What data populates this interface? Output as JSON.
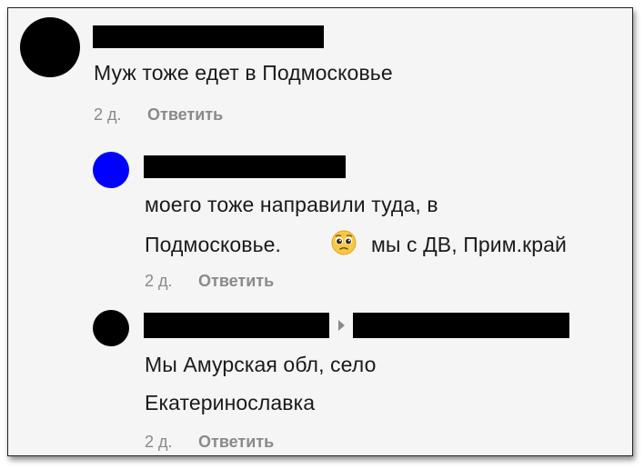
{
  "colors": {
    "frame_bg": "#f5f5f5",
    "avatar_black": "#000000",
    "avatar_blue": "#0000ff",
    "meta_gray": "#8a8a8a",
    "text": "#1a1a1a"
  },
  "comments": [
    {
      "body_lines": [
        "Муж тоже едет в Подмосковье"
      ],
      "time": "2 д.",
      "reply_label": "Ответить"
    },
    {
      "body_lines": [
        "моего тоже направили туда, в",
        "Подмосковье.",
        "мы с ДВ, Прим.край"
      ],
      "emoji": "pleading-face-icon",
      "time": "2 д.",
      "reply_label": "Ответить"
    },
    {
      "body_lines": [
        "Мы Амурская обл, село",
        "Екатеринославка"
      ],
      "time": "2 д.",
      "reply_label": "Ответить"
    }
  ]
}
